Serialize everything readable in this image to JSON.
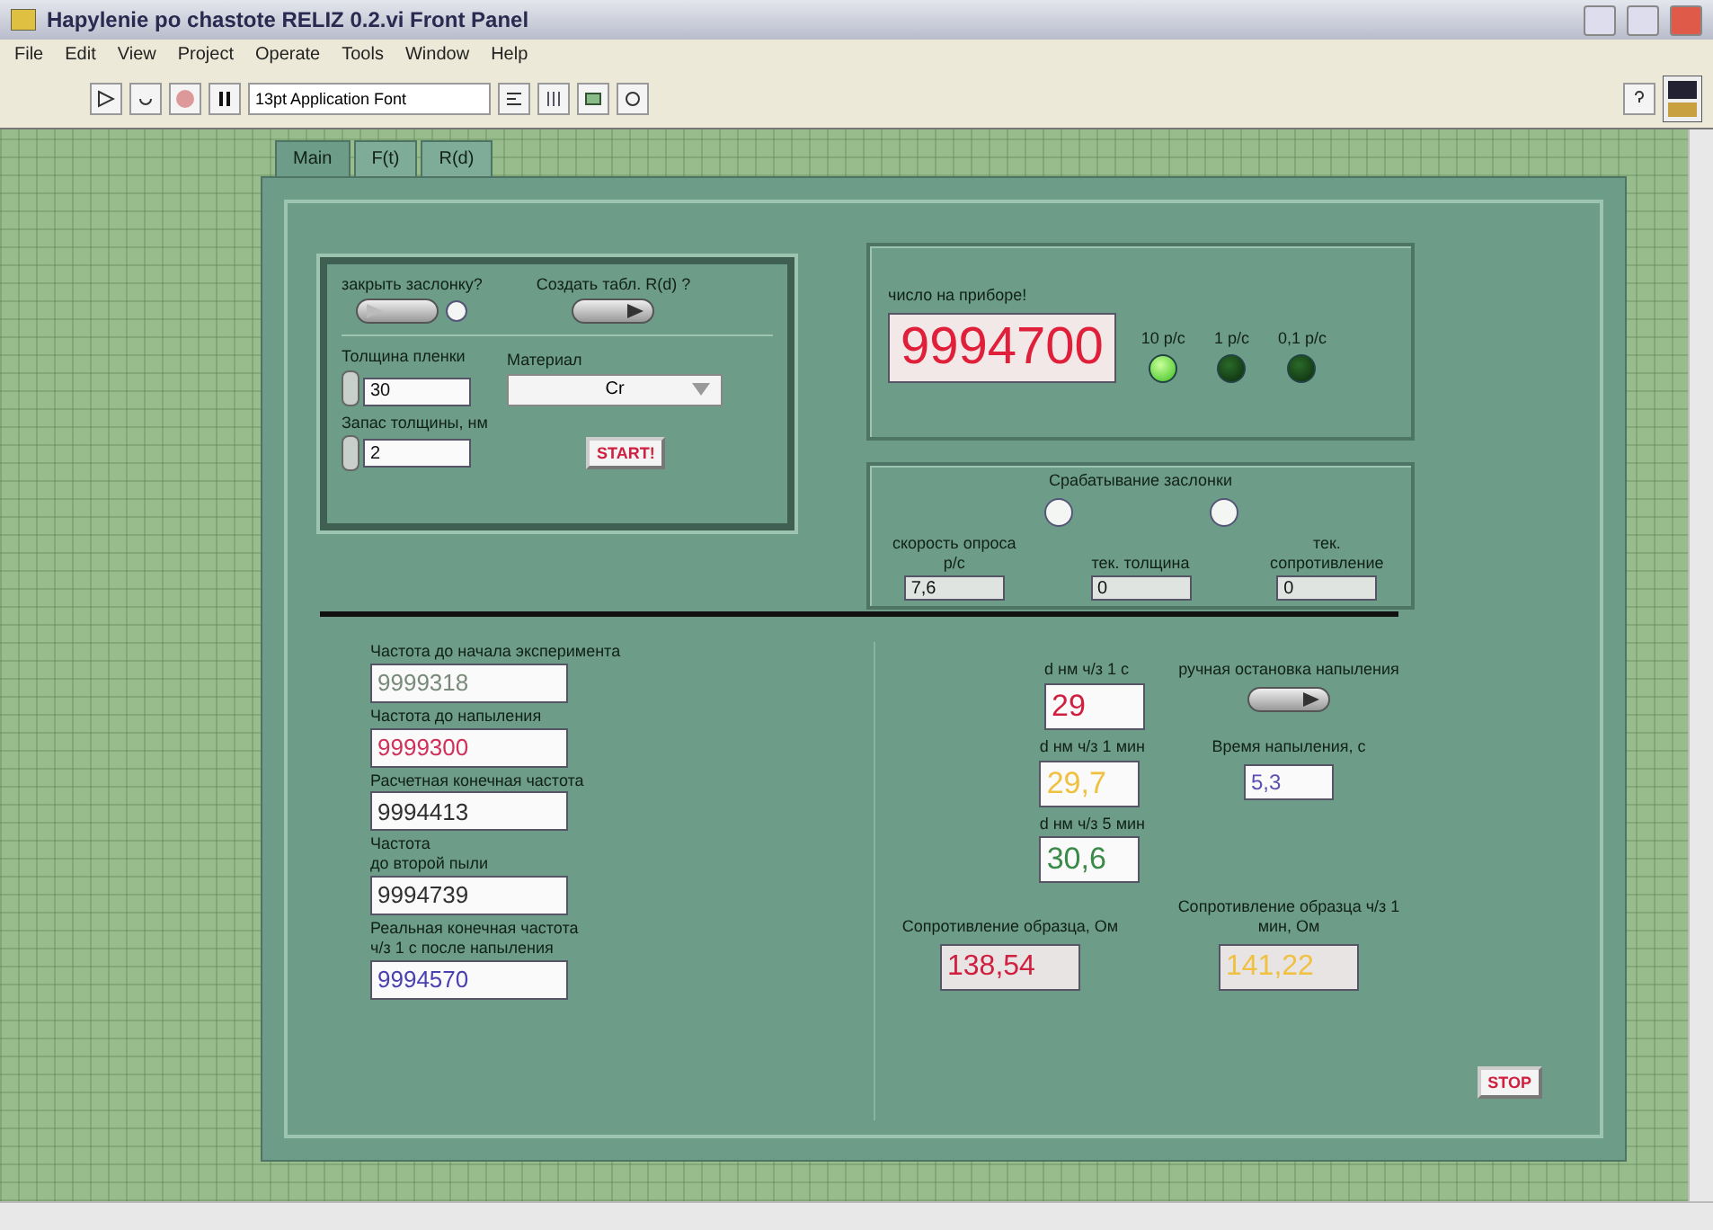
{
  "window": {
    "title": "Hapylenie po chastote RELIZ 0.2.vi Front Panel"
  },
  "menu": [
    "File",
    "Edit",
    "View",
    "Project",
    "Operate",
    "Tools",
    "Window",
    "Help"
  ],
  "toolbar": {
    "font": "13pt Application Font"
  },
  "tabs": [
    {
      "label": "Main",
      "selected": true
    },
    {
      "label": "F(t)",
      "selected": false
    },
    {
      "label": "R(d)",
      "selected": false
    }
  ],
  "setup": {
    "switches": [
      {
        "label": "закрыть заслонку?",
        "on": false
      },
      {
        "label": "Создать табл. R(d) ?",
        "on": true
      }
    ],
    "thickness": {
      "label": "Толщина пленки",
      "value": "30"
    },
    "material": {
      "label": "Материал",
      "value": "Cr"
    },
    "reserve": {
      "label": "Запас толщины, нм",
      "value": "2"
    },
    "start_button": "START!"
  },
  "counter": {
    "label": "число на приборе!",
    "value": "9994700",
    "rates": [
      {
        "label": "10 р/с",
        "on": true
      },
      {
        "label": "1 р/с",
        "on": false
      },
      {
        "label": "0,1 р/с",
        "on": false
      }
    ]
  },
  "shutter": {
    "title": "Срабатывание заслонки",
    "lamps": [
      {
        "on": false
      },
      {
        "on": false
      }
    ],
    "readouts": [
      {
        "label": "скорость опроса р/с",
        "value": "7,6"
      },
      {
        "label": "тек. толщина",
        "value": "0"
      },
      {
        "label": "тек. сопротивление",
        "value": "0"
      }
    ]
  },
  "frequencies": [
    {
      "label": "Частота до начала эксперимента",
      "value": "9999318",
      "color": "#7a8a7a"
    },
    {
      "label": "Частота до напыления",
      "value": "9999300",
      "color": "#d0305a"
    },
    {
      "label": "Расчетная конечная частота",
      "value": "9994413",
      "color": "#303030"
    },
    {
      "label": "Частота\nдо второй пыли",
      "value": "9994739",
      "color": "#303030"
    },
    {
      "label": "Реальная конечная частота\nч/з 1 с после напыления",
      "value": "9994570",
      "color": "#4a40b0"
    }
  ],
  "thickness_readouts": [
    {
      "label": "d нм ч/з 1 с",
      "value": "29",
      "color": "#d02040"
    },
    {
      "label": "d нм ч/з 1 мин",
      "value": "29,7",
      "color": "#f0c040"
    },
    {
      "label": "d нм ч/з 5 мин",
      "value": "30,6",
      "color": "#3a8a4a"
    }
  ],
  "manual_stop": {
    "label": "ручная остановка напыления",
    "on": true
  },
  "duration": {
    "label": "Время напыления, с",
    "value": "5,3",
    "color": "#5a50b0"
  },
  "resistance": [
    {
      "label": "Сопротивление образца, Ом",
      "value": "138,54",
      "color": "#d02040"
    },
    {
      "label": "Сопротивление образца ч/з 1 мин, Ом",
      "value": "141,22",
      "color": "#f0c040"
    }
  ],
  "stop_button": "STOP"
}
